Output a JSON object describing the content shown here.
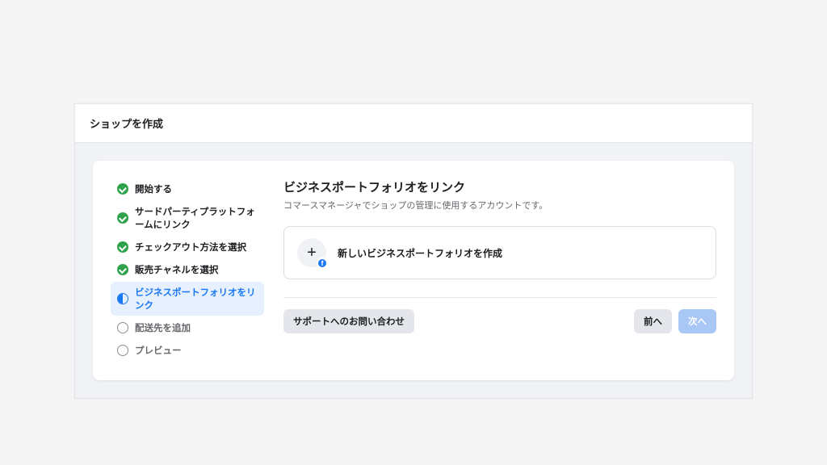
{
  "header": {
    "title": "ショップを作成"
  },
  "steps": [
    {
      "label": "開始する",
      "state": "done"
    },
    {
      "label": "サードパーティプラットフォームにリンク",
      "state": "done"
    },
    {
      "label": "チェックアウト方法を選択",
      "state": "done"
    },
    {
      "label": "販売チャネルを選択",
      "state": "done"
    },
    {
      "label": "ビジネスポートフォリオをリンク",
      "state": "active"
    },
    {
      "label": "配送先を追加",
      "state": "pending"
    },
    {
      "label": "プレビュー",
      "state": "pending"
    }
  ],
  "main": {
    "title": "ビジネスポートフォリオをリンク",
    "subtitle": "コマースマネージャでショップの管理に使用するアカウントです。",
    "option_label": "新しいビジネスポートフォリオを作成"
  },
  "footer": {
    "support_label": "サポートへのお問い合わせ",
    "back_label": "前へ",
    "next_label": "次へ"
  }
}
